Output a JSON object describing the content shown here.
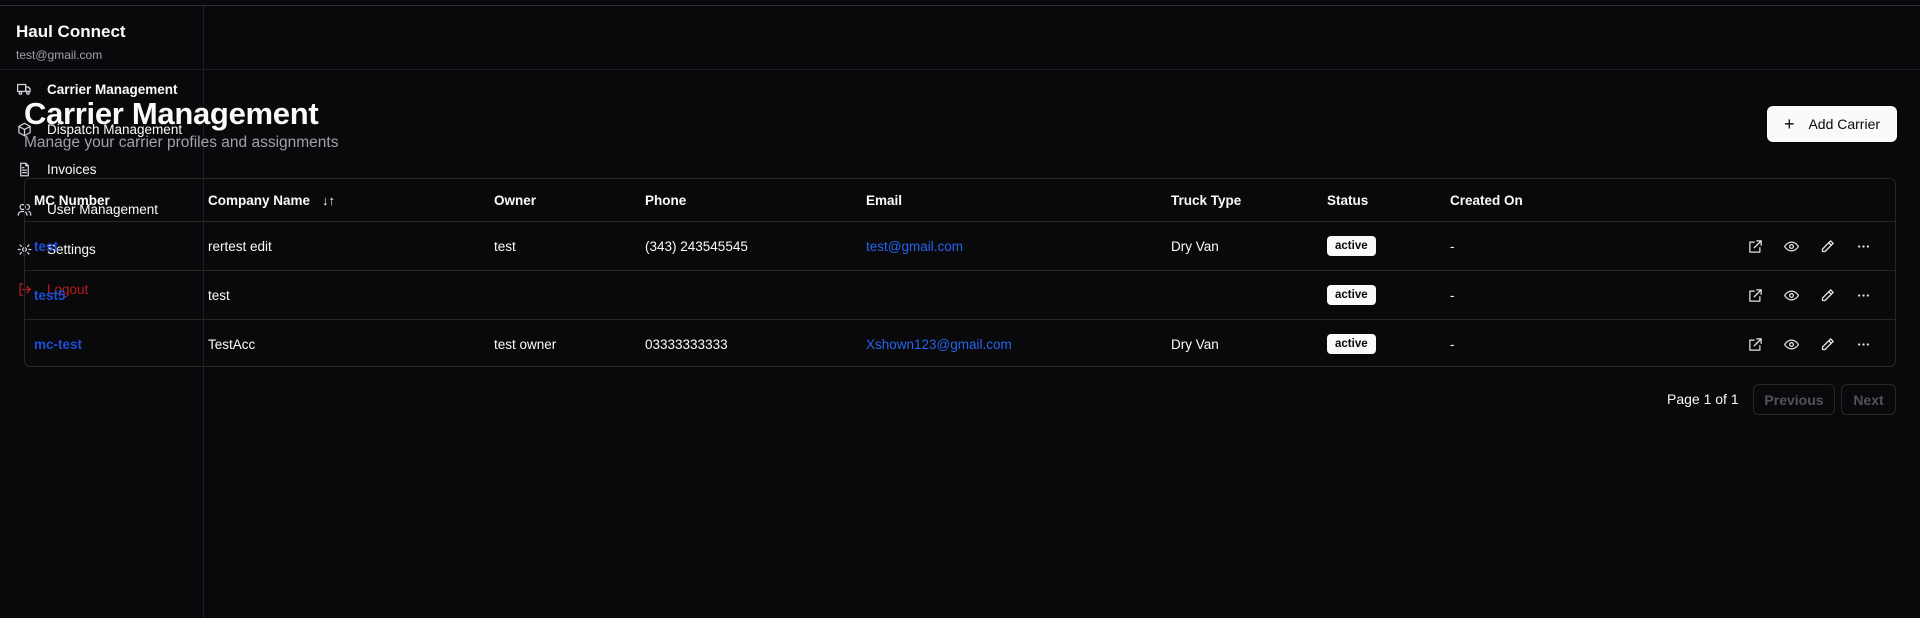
{
  "brand": {
    "title": "Haul Connect",
    "email": "test@gmail.com"
  },
  "sidebar": {
    "items": [
      {
        "label": "Carrier Management",
        "icon": "truck-icon",
        "active": true
      },
      {
        "label": "Dispatch Management",
        "icon": "package-icon",
        "active": false
      },
      {
        "label": "Invoices",
        "icon": "file-text-icon",
        "active": false
      },
      {
        "label": "User Management",
        "icon": "users-icon",
        "active": false
      },
      {
        "label": "Settings",
        "icon": "gear-icon",
        "active": false
      },
      {
        "label": "Logout",
        "icon": "logout-icon",
        "active": false
      }
    ]
  },
  "page": {
    "title": "Carrier Management",
    "subtitle": "Manage your carrier profiles and assignments",
    "add_button": "Add Carrier"
  },
  "table": {
    "columns": [
      "MC Number",
      "Company Name",
      "Owner",
      "Phone",
      "Email",
      "Truck Type",
      "Status",
      "Created On"
    ],
    "rows": [
      {
        "mc": "test",
        "company": "rertest edit",
        "owner": "test",
        "phone": "(343) 243545545",
        "email": "test@gmail.com",
        "truck": "Dry Van",
        "status": "active",
        "created": "-"
      },
      {
        "mc": "test5",
        "company": "test",
        "owner": "",
        "phone": "",
        "email": "",
        "truck": "",
        "status": "active",
        "created": "-"
      },
      {
        "mc": "mc-test",
        "company": "TestAcc",
        "owner": "test owner",
        "phone": "03333333333",
        "email": "Xshown123@gmail.com",
        "truck": "Dry Van",
        "status": "active",
        "created": "-"
      }
    ]
  },
  "pagination": {
    "text": "Page 1 of 1",
    "previous": "Previous",
    "next": "Next"
  },
  "colors": {
    "background": "#09090b",
    "link": "#2563eb",
    "logout": "#b91c1c"
  }
}
